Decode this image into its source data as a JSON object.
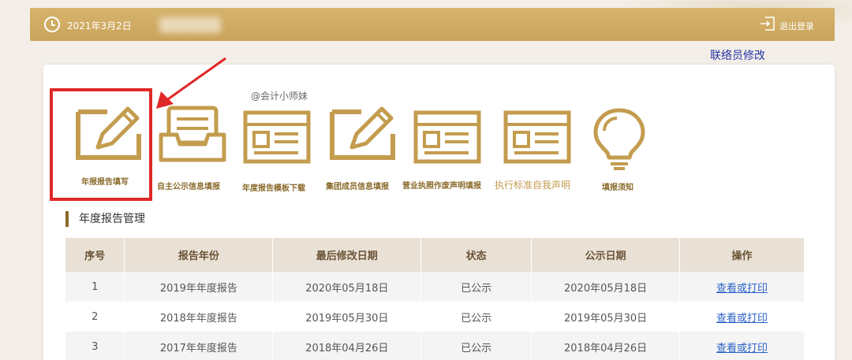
{
  "header": {
    "date": "2021年3月2日",
    "logout_label": "退出登录"
  },
  "contact_link": "联络员修改",
  "watermark": "@会计小师妹",
  "tiles": [
    {
      "label": "年报报告填写",
      "icon": "pencil-edit-icon"
    },
    {
      "label": "自主公示信息填报",
      "icon": "inbox-tray-icon"
    },
    {
      "label": "年度报告模板下载",
      "icon": "document-template-icon"
    },
    {
      "label": "集团成员信息填报",
      "icon": "pencil-edit-icon"
    },
    {
      "label": "营业执照作废声明填报",
      "icon": "document-template-icon"
    },
    {
      "label": "执行标准自我声明",
      "icon": "document-template-icon"
    },
    {
      "label": "填报须知",
      "icon": "lightbulb-icon"
    }
  ],
  "section_title": "年度报告管理",
  "table": {
    "headers": [
      "序号",
      "报告年份",
      "最后修改日期",
      "状态",
      "公示日期",
      "操作"
    ],
    "rows": [
      {
        "no": "1",
        "year": "2019年年度报告",
        "modified": "2020年05月18日",
        "status": "已公示",
        "published": "2020年05月18日",
        "action": "查看或打印"
      },
      {
        "no": "2",
        "year": "2018年年度报告",
        "modified": "2019年05月30日",
        "status": "已公示",
        "published": "2019年05月30日",
        "action": "查看或打印"
      },
      {
        "no": "3",
        "year": "2017年年度报告",
        "modified": "2018年04月26日",
        "status": "已公示",
        "published": "2018年04月26日",
        "action": "查看或打印"
      }
    ]
  },
  "colors": {
    "gold": "#c9a35a",
    "icon_gold": "#c39c4e",
    "highlight_red": "#e02828",
    "link_blue": "#2b62c8"
  }
}
